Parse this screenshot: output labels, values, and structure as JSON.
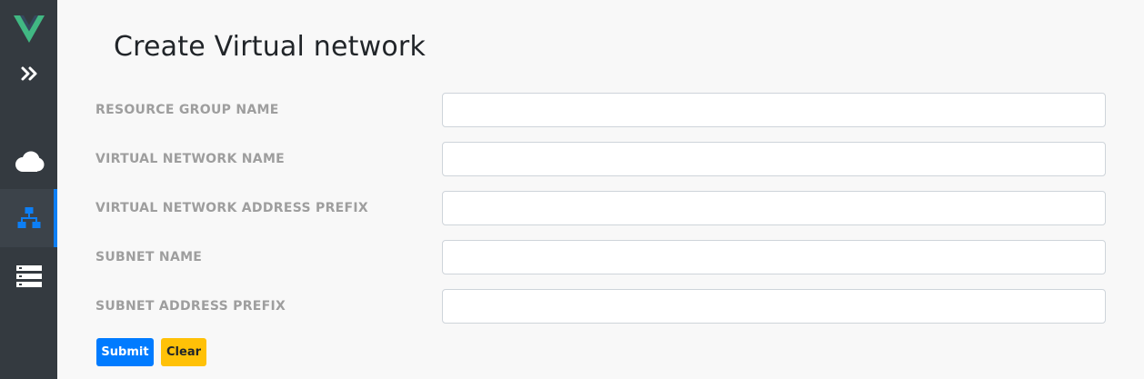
{
  "sidebar": {
    "items": [
      {
        "name": "vue-logo-icon"
      },
      {
        "name": "expand-chevrons-icon"
      },
      {
        "name": "cloud-icon"
      },
      {
        "name": "network-sitemap-icon",
        "active": true
      },
      {
        "name": "storage-server-icon"
      }
    ],
    "colors": {
      "background": "#343a40",
      "active_indicator": "#0d7ff5",
      "active_icon": "#0d7ff5",
      "icon": "#ffffff",
      "logo_green": "#41b883"
    }
  },
  "main": {
    "title": "Create Virtual network",
    "fields": [
      {
        "label": "RESOURCE GROUP NAME",
        "value": "",
        "placeholder": ""
      },
      {
        "label": "VIRTUAL NETWORK NAME",
        "value": "",
        "placeholder": ""
      },
      {
        "label": "VIRTUAL NETWORK ADDRESS PREFIX",
        "value": "",
        "placeholder": ""
      },
      {
        "label": "SUBNET NAME",
        "value": "",
        "placeholder": ""
      },
      {
        "label": "SUBNET ADDRESS PREFIX",
        "value": "",
        "placeholder": ""
      }
    ],
    "buttons": {
      "submit_label": "Submit",
      "clear_label": "Clear"
    },
    "colors": {
      "submit": "#007bff",
      "clear": "#ffc107",
      "label": "#9e9e9e"
    }
  }
}
